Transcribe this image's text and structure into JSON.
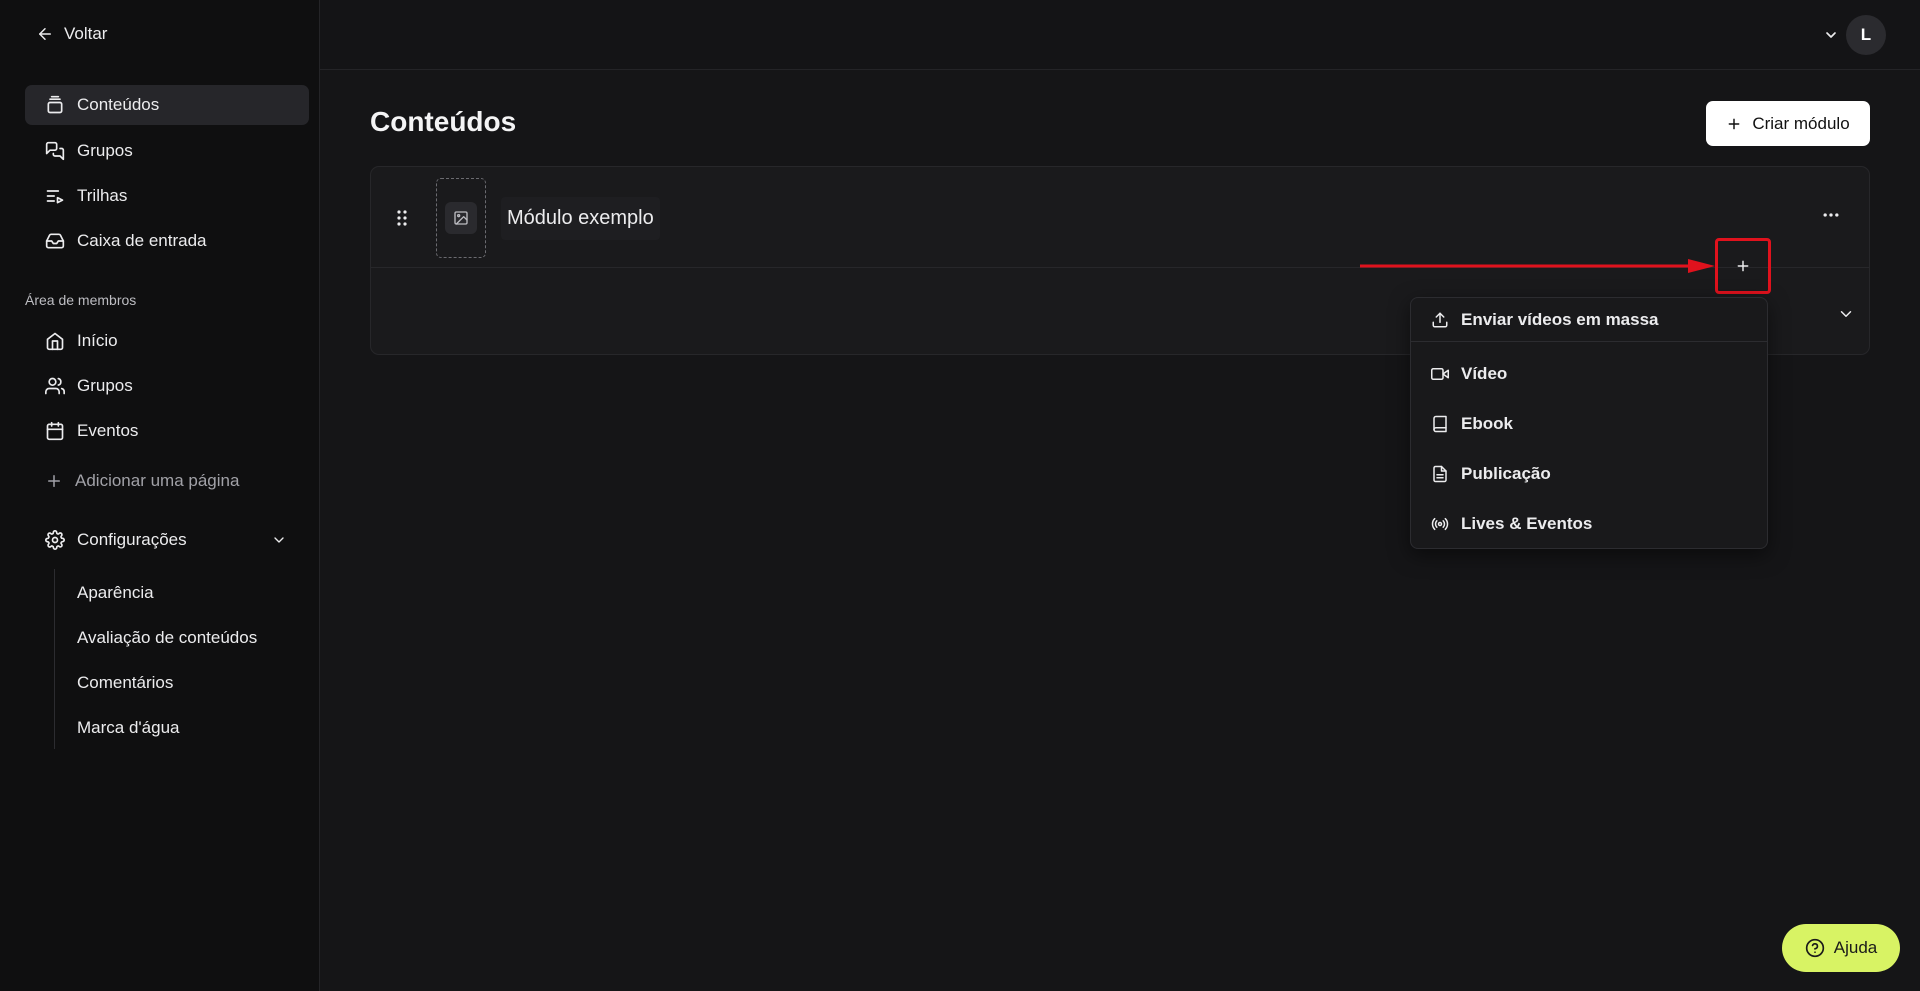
{
  "sidebar": {
    "back_label": "Voltar",
    "main_items": [
      {
        "label": "Conteúdos",
        "icon": "stack-icon",
        "active": true
      },
      {
        "label": "Grupos",
        "icon": "chat-icon"
      },
      {
        "label": "Trilhas",
        "icon": "list-play-icon"
      },
      {
        "label": "Caixa de entrada",
        "icon": "inbox-icon"
      }
    ],
    "section_label": "Área de membros",
    "member_items": [
      {
        "label": "Início",
        "icon": "home-icon"
      },
      {
        "label": "Grupos",
        "icon": "users-icon"
      },
      {
        "label": "Eventos",
        "icon": "calendar-icon"
      }
    ],
    "add_page_label": "Adicionar uma página",
    "settings_label": "Configurações",
    "settings_items": [
      {
        "label": "Aparência"
      },
      {
        "label": "Avaliação de conteúdos"
      },
      {
        "label": "Comentários"
      },
      {
        "label": "Marca d'água"
      }
    ]
  },
  "topbar": {
    "avatar_initial": "L"
  },
  "main": {
    "title": "Conteúdos",
    "create_button_label": "Criar módulo",
    "module": {
      "name": "Módulo exemplo"
    }
  },
  "menu": {
    "items": [
      {
        "label": "Enviar vídeos em massa",
        "icon": "upload-icon"
      },
      {
        "label": "Vídeo",
        "icon": "video-icon"
      },
      {
        "label": "Ebook",
        "icon": "book-icon"
      },
      {
        "label": "Publicação",
        "icon": "document-icon"
      },
      {
        "label": "Lives & Eventos",
        "icon": "broadcast-icon"
      }
    ]
  },
  "help": {
    "label": "Ajuda"
  },
  "colors": {
    "background": "#151517",
    "sidebar": "#0f0f10",
    "highlight_red": "#e0121d",
    "help_green": "#d8f364"
  }
}
